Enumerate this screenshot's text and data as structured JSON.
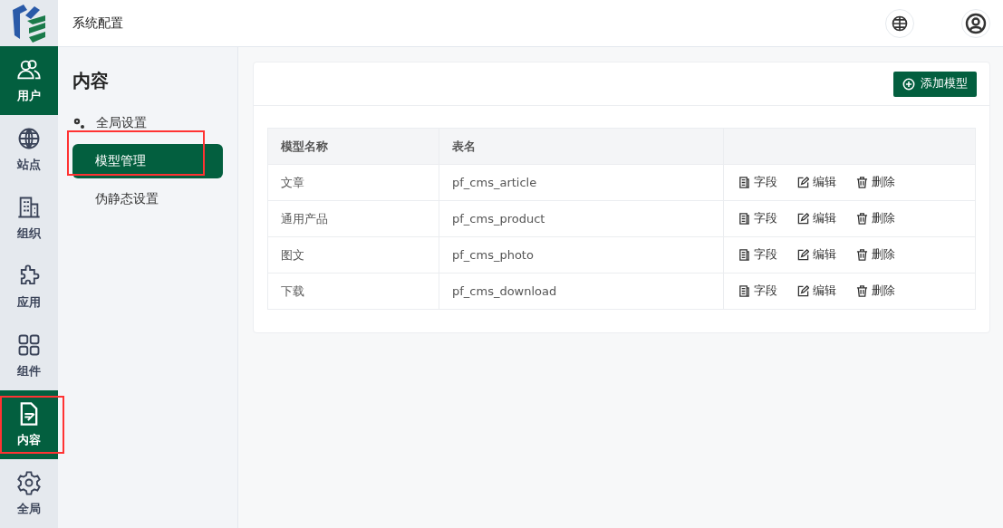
{
  "header": {
    "title": "系统配置"
  },
  "rail": [
    {
      "label": "用户",
      "selected": true,
      "highlighted": false
    },
    {
      "label": "站点",
      "selected": false,
      "highlighted": false
    },
    {
      "label": "组织",
      "selected": false,
      "highlighted": false
    },
    {
      "label": "应用",
      "selected": false,
      "highlighted": false
    },
    {
      "label": "组件",
      "selected": false,
      "highlighted": false
    },
    {
      "label": "内容",
      "selected": true,
      "highlighted": true
    },
    {
      "label": "全局",
      "selected": false,
      "highlighted": false
    }
  ],
  "submenu": {
    "title": "内容",
    "items": [
      {
        "label": "全局设置",
        "selected": false,
        "highlighted": false
      },
      {
        "label": "模型管理",
        "selected": true,
        "highlighted": true
      },
      {
        "label": "伪静态设置",
        "selected": false,
        "highlighted": false
      }
    ]
  },
  "add_button": "添加模型",
  "table": {
    "columns": [
      "模型名称",
      "表名"
    ],
    "rows": [
      {
        "name": "文章",
        "table": "pf_cms_article",
        "actions": [
          "字段",
          "编辑",
          "删除"
        ]
      },
      {
        "name": "通用产品",
        "table": "pf_cms_product",
        "actions": [
          "字段",
          "编辑",
          "删除"
        ]
      },
      {
        "name": "图文",
        "table": "pf_cms_photo",
        "actions": [
          "字段",
          "编辑",
          "删除"
        ]
      },
      {
        "name": "下载",
        "table": "pf_cms_download",
        "actions": [
          "字段",
          "编辑",
          "删除"
        ]
      }
    ]
  }
}
